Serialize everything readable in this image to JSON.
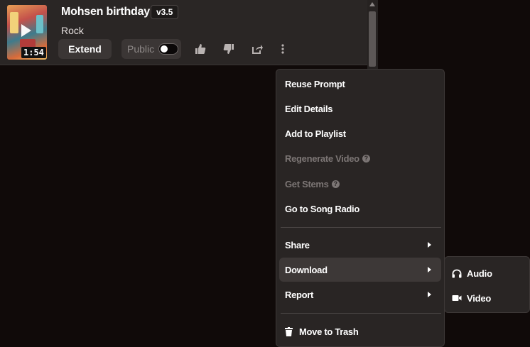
{
  "track": {
    "title": "Mohsen birthday",
    "version": "v3.5",
    "genre": "Rock",
    "duration": "1:54",
    "extend_label": "Extend",
    "public_label": "Public",
    "public_enabled": false
  },
  "icons": {
    "like": "thumbs-up-icon",
    "dislike": "thumbs-down-icon",
    "share": "share-icon",
    "more": "more-vertical-icon"
  },
  "menu": {
    "items": [
      {
        "label": "Reuse Prompt",
        "disabled": false
      },
      {
        "label": "Edit Details",
        "disabled": false
      },
      {
        "label": "Add to Playlist",
        "disabled": false
      },
      {
        "label": "Regenerate Video",
        "disabled": true,
        "help": true
      },
      {
        "label": "Get Stems",
        "disabled": true,
        "help": true
      },
      {
        "label": "Go to Song Radio",
        "disabled": false
      }
    ],
    "share": "Share",
    "download": "Download",
    "report": "Report",
    "trash": "Move to Trash"
  },
  "download_submenu": {
    "audio": "Audio",
    "video": "Video"
  },
  "colors": {
    "background": "#100a09",
    "card": "#2a2625",
    "menu": "#292524",
    "active_item": "#3d3837",
    "disabled_text": "#7c7675"
  }
}
